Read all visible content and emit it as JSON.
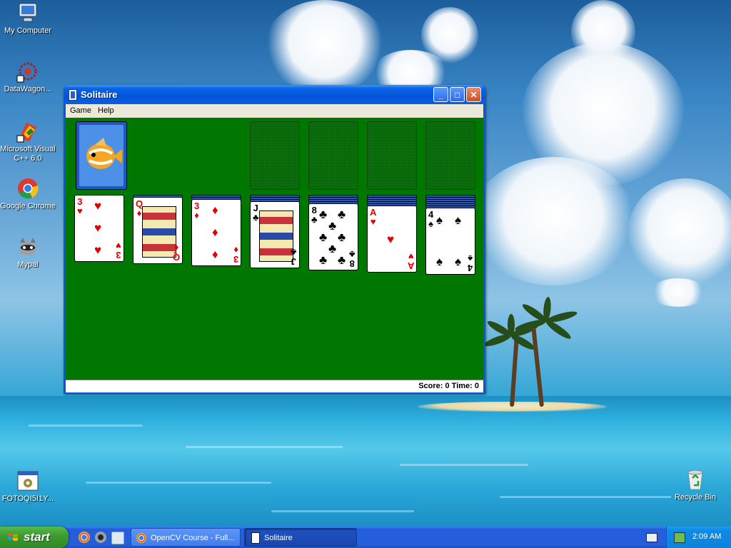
{
  "desktop": {
    "icons": [
      {
        "label": "My Computer"
      },
      {
        "label": "DataWagon..."
      },
      {
        "label": "Microsoft Visual C++ 6.0"
      },
      {
        "label": "Google Chrome"
      },
      {
        "label": "Mypal"
      },
      {
        "label": "FOTOQI5I1Y..."
      },
      {
        "label": "Recycle Bin"
      }
    ]
  },
  "window": {
    "title": "Solitaire",
    "buttons": {
      "minimize": "_",
      "maximize": "□",
      "close": "✕"
    },
    "menu": [
      "Game",
      "Help"
    ],
    "status": "Score: 0 Time: 0"
  },
  "game": {
    "stock": {
      "back": "fish"
    },
    "foundations": 4,
    "tableau": [
      {
        "rank": "3",
        "suit": "♥",
        "color": "red",
        "hidden": 0
      },
      {
        "rank": "Q",
        "suit": "♦",
        "color": "red",
        "hidden": 1
      },
      {
        "rank": "3",
        "suit": "♦",
        "color": "red",
        "hidden": 2
      },
      {
        "rank": "J",
        "suit": "♣",
        "color": "black",
        "hidden": 3
      },
      {
        "rank": "8",
        "suit": "♣",
        "color": "black",
        "hidden": 4
      },
      {
        "rank": "A",
        "suit": "♥",
        "color": "red",
        "hidden": 5
      },
      {
        "rank": "4",
        "suit": "♠",
        "color": "black",
        "hidden": 6
      }
    ]
  },
  "taskbar": {
    "start_label": "start",
    "quick_launch": [
      "chrome-icon",
      "mypal-icon",
      "ie-icon"
    ],
    "tasks": [
      {
        "label": "OpenCV Course - Full..."
      },
      {
        "label": "Solitaire"
      }
    ],
    "clock": "2:09 AM"
  },
  "colors": {
    "felt": "#007800",
    "titlebar": "#0355d8",
    "card_back": "#1e57c6",
    "red_suit": "#e00000"
  }
}
